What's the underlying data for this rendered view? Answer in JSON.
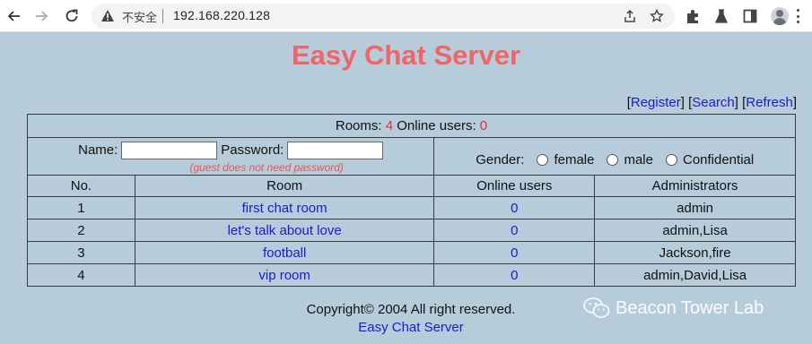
{
  "browser": {
    "insecure_label": "不安全",
    "url": "192.168.220.128"
  },
  "page": {
    "title": "Easy Chat Server",
    "links": {
      "register": "Register",
      "search": "Search",
      "refresh": "Refresh"
    },
    "status": {
      "rooms_label": "Rooms:",
      "rooms_count": "4",
      "online_label": "Online users:",
      "online_count": "0"
    },
    "login": {
      "name_label": "Name:",
      "name_value": "",
      "password_label": "Password:",
      "password_value": "",
      "guest_hint": "(guest does not need password)"
    },
    "gender": {
      "label": "Gender:",
      "options": [
        "female",
        "male",
        "Confidential"
      ]
    },
    "table": {
      "headers": [
        "No.",
        "Room",
        "Online users",
        "Administrators"
      ],
      "rows": [
        {
          "no": "1",
          "room": "first chat room",
          "online": "0",
          "admins": "admin"
        },
        {
          "no": "2",
          "room": "let's talk about love",
          "online": "0",
          "admins": "admin,Lisa"
        },
        {
          "no": "3",
          "room": "football",
          "online": "0",
          "admins": "Jackson,fire"
        },
        {
          "no": "4",
          "room": "vip room",
          "online": "0",
          "admins": "admin,David,Lisa"
        }
      ]
    },
    "footer": {
      "copyright": "Copyright© 2004 All right reserved.",
      "link": "Easy Chat Server"
    },
    "watermark": "Beacon Tower Lab"
  },
  "colors": {
    "background": "#b6ccda",
    "title": "#ee6666",
    "link": "#1a1acc",
    "count_red": "#e23030"
  }
}
